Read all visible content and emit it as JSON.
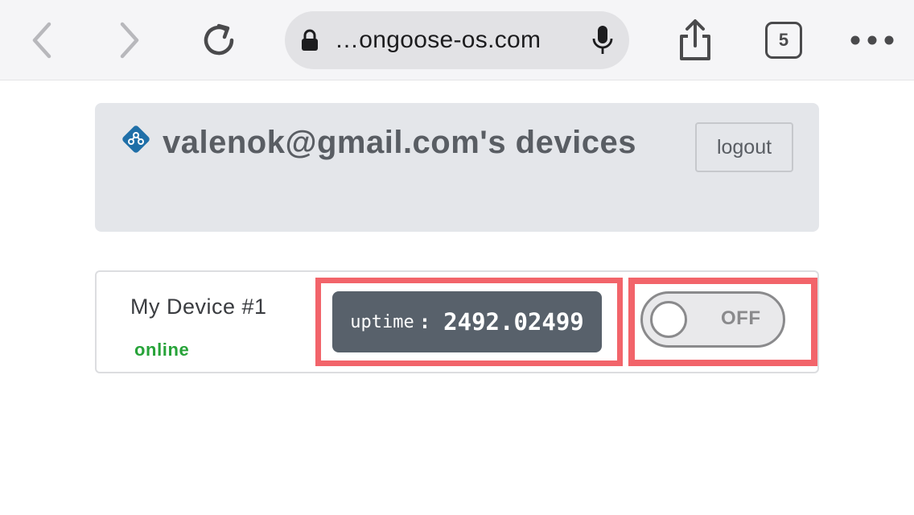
{
  "browser": {
    "url_display": "…ongoose-os.com",
    "tab_count": "5",
    "icons": {
      "back": "chevron-left-icon",
      "forward": "chevron-right-icon",
      "reload": "reload-icon",
      "lock": "lock-icon",
      "mic": "microphone-icon",
      "share": "share-icon",
      "tabs": "tabs-icon",
      "more": "more-icon"
    }
  },
  "header": {
    "title": "valenok@gmail.com's devices",
    "logout_label": "logout",
    "logo_icon": "mongoose-logo-icon"
  },
  "devices": [
    {
      "name": "My Device #1",
      "status": "online",
      "uptime_label": "uptime",
      "uptime_separator": ":",
      "uptime_value": "2492.02499",
      "toggle_label": "OFF",
      "toggle_state": false
    }
  ],
  "colors": {
    "header_bg": "#e4e6ea",
    "online": "#27a339",
    "uptime_bg": "#58616b",
    "highlight": "#f2646a",
    "toggle": "#8a8a8c"
  }
}
